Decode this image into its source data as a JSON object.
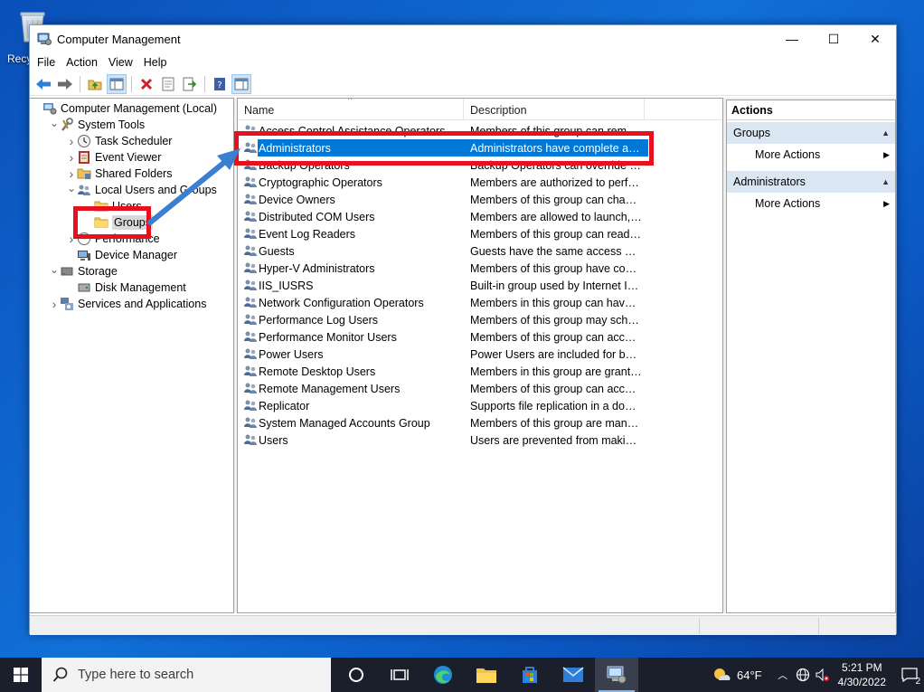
{
  "desktop": {
    "recycle_label": "Recy"
  },
  "window": {
    "title": "Computer Management",
    "controls": {
      "minimize": "—",
      "maximize": "☐",
      "close": "✕"
    }
  },
  "menu": [
    "File",
    "Action",
    "View",
    "Help"
  ],
  "tree": [
    {
      "label": "Computer Management (Local)",
      "icon": "computer-management-icon",
      "expander": ""
    },
    {
      "label": "System Tools",
      "icon": "system-tools-icon",
      "expander": "expanded"
    },
    {
      "label": "Task Scheduler",
      "icon": "clock-icon",
      "expander": "collapsed"
    },
    {
      "label": "Event Viewer",
      "icon": "event-viewer-icon",
      "expander": "collapsed"
    },
    {
      "label": "Shared Folders",
      "icon": "shared-folder-icon",
      "expander": "collapsed"
    },
    {
      "label": "Local Users and Groups",
      "icon": "users-groups-icon",
      "expander": "expanded"
    },
    {
      "label": "Users",
      "icon": "folder-icon",
      "expander": ""
    },
    {
      "label": "Groups",
      "icon": "folder-icon",
      "expander": "",
      "selected": true
    },
    {
      "label": "Performance",
      "icon": "performance-icon",
      "expander": "collapsed"
    },
    {
      "label": "Device Manager",
      "icon": "device-manager-icon",
      "expander": ""
    },
    {
      "label": "Storage",
      "icon": "storage-icon",
      "expander": "expanded"
    },
    {
      "label": "Disk Management",
      "icon": "disk-icon",
      "expander": ""
    },
    {
      "label": "Services and Applications",
      "icon": "services-icon",
      "expander": "collapsed"
    }
  ],
  "list": {
    "columns": [
      "Name",
      "Description"
    ],
    "rows": [
      {
        "name": "Access Control Assistance Operators",
        "desc": "Members of this group can remot..."
      },
      {
        "name": "Administrators",
        "desc": "Administrators have complete an...",
        "selected": true
      },
      {
        "name": "Backup Operators",
        "desc": "Backup Operators can override se..."
      },
      {
        "name": "Cryptographic Operators",
        "desc": "Members are authorized to perfor..."
      },
      {
        "name": "Device Owners",
        "desc": "Members of this group can chang..."
      },
      {
        "name": "Distributed COM Users",
        "desc": "Members are allowed to launch, a..."
      },
      {
        "name": "Event Log Readers",
        "desc": "Members of this group can read e..."
      },
      {
        "name": "Guests",
        "desc": "Guests have the same access as m..."
      },
      {
        "name": "Hyper-V Administrators",
        "desc": "Members of this group have com..."
      },
      {
        "name": "IIS_IUSRS",
        "desc": "Built-in group used by Internet Inf..."
      },
      {
        "name": "Network Configuration Operators",
        "desc": "Members in this group can have s..."
      },
      {
        "name": "Performance Log Users",
        "desc": "Members of this group may sche..."
      },
      {
        "name": "Performance Monitor Users",
        "desc": "Members of this group can acces..."
      },
      {
        "name": "Power Users",
        "desc": "Power Users are included for back..."
      },
      {
        "name": "Remote Desktop Users",
        "desc": "Members in this group are grante..."
      },
      {
        "name": "Remote Management Users",
        "desc": "Members of this group can acces..."
      },
      {
        "name": "Replicator",
        "desc": "Supports file replication in a dom..."
      },
      {
        "name": "System Managed Accounts Group",
        "desc": "Members of this group are mana..."
      },
      {
        "name": "Users",
        "desc": "Users are prevented from making ..."
      }
    ]
  },
  "actions": {
    "title": "Actions",
    "sections": [
      {
        "header": "Groups",
        "item": "More Actions"
      },
      {
        "header": "Administrators",
        "item": "More Actions"
      }
    ]
  },
  "taskbar": {
    "search_placeholder": "Type here to search",
    "weather": "64°F",
    "time": "5:21 PM",
    "date": "4/30/2022",
    "notifications": "2"
  },
  "colors": {
    "highlight": "#e8101c",
    "selection": "#0078d7",
    "arrow": "#3a7fd0"
  }
}
